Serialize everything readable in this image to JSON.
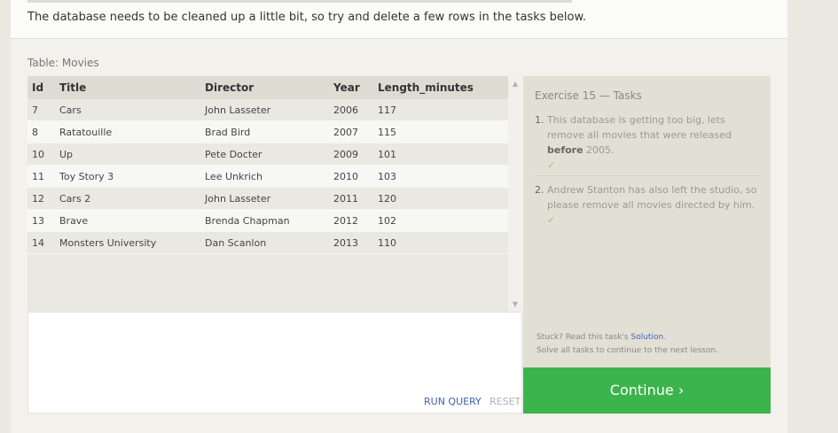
{
  "intro": {
    "text": "The database needs to be cleaned up a little bit, so try and delete a few rows in the tasks below."
  },
  "table": {
    "caption": "Table: Movies",
    "columns": [
      "Id",
      "Title",
      "Director",
      "Year",
      "Length_minutes"
    ],
    "rows": [
      [
        "7",
        "Cars",
        "John Lasseter",
        "2006",
        "117"
      ],
      [
        "8",
        "Ratatouille",
        "Brad Bird",
        "2007",
        "115"
      ],
      [
        "10",
        "Up",
        "Pete Docter",
        "2009",
        "101"
      ],
      [
        "11",
        "Toy Story 3",
        "Lee Unkrich",
        "2010",
        "103"
      ],
      [
        "12",
        "Cars 2",
        "John Lasseter",
        "2011",
        "120"
      ],
      [
        "13",
        "Brave",
        "Brenda Chapman",
        "2012",
        "102"
      ],
      [
        "14",
        "Monsters University",
        "Dan Scanlon",
        "2013",
        "110"
      ]
    ]
  },
  "editor": {
    "run_label": "RUN QUERY",
    "reset_label": "RESET"
  },
  "tasks": {
    "title": "Exercise 15 — Tasks",
    "items": [
      {
        "num": "1.",
        "text_before": "This database is getting too big, lets remove all movies that were released ",
        "bold": "before",
        "text_after": " 2005.",
        "check": "✓"
      },
      {
        "num": "2.",
        "text": "Andrew Stanton has also left the studio, so please remove all movies directed by him.",
        "check": "✓"
      }
    ],
    "stuck_prefix": "Stuck? Read this task's ",
    "solution_link": "Solution",
    "stuck_suffix": ".",
    "stuck_line2": "Solve all tasks to continue to the next lesson.",
    "continue_label": "Continue ›"
  },
  "colors": {
    "accent": "#3ab44b",
    "link": "#3f63b3",
    "check": "#8dc98b"
  }
}
